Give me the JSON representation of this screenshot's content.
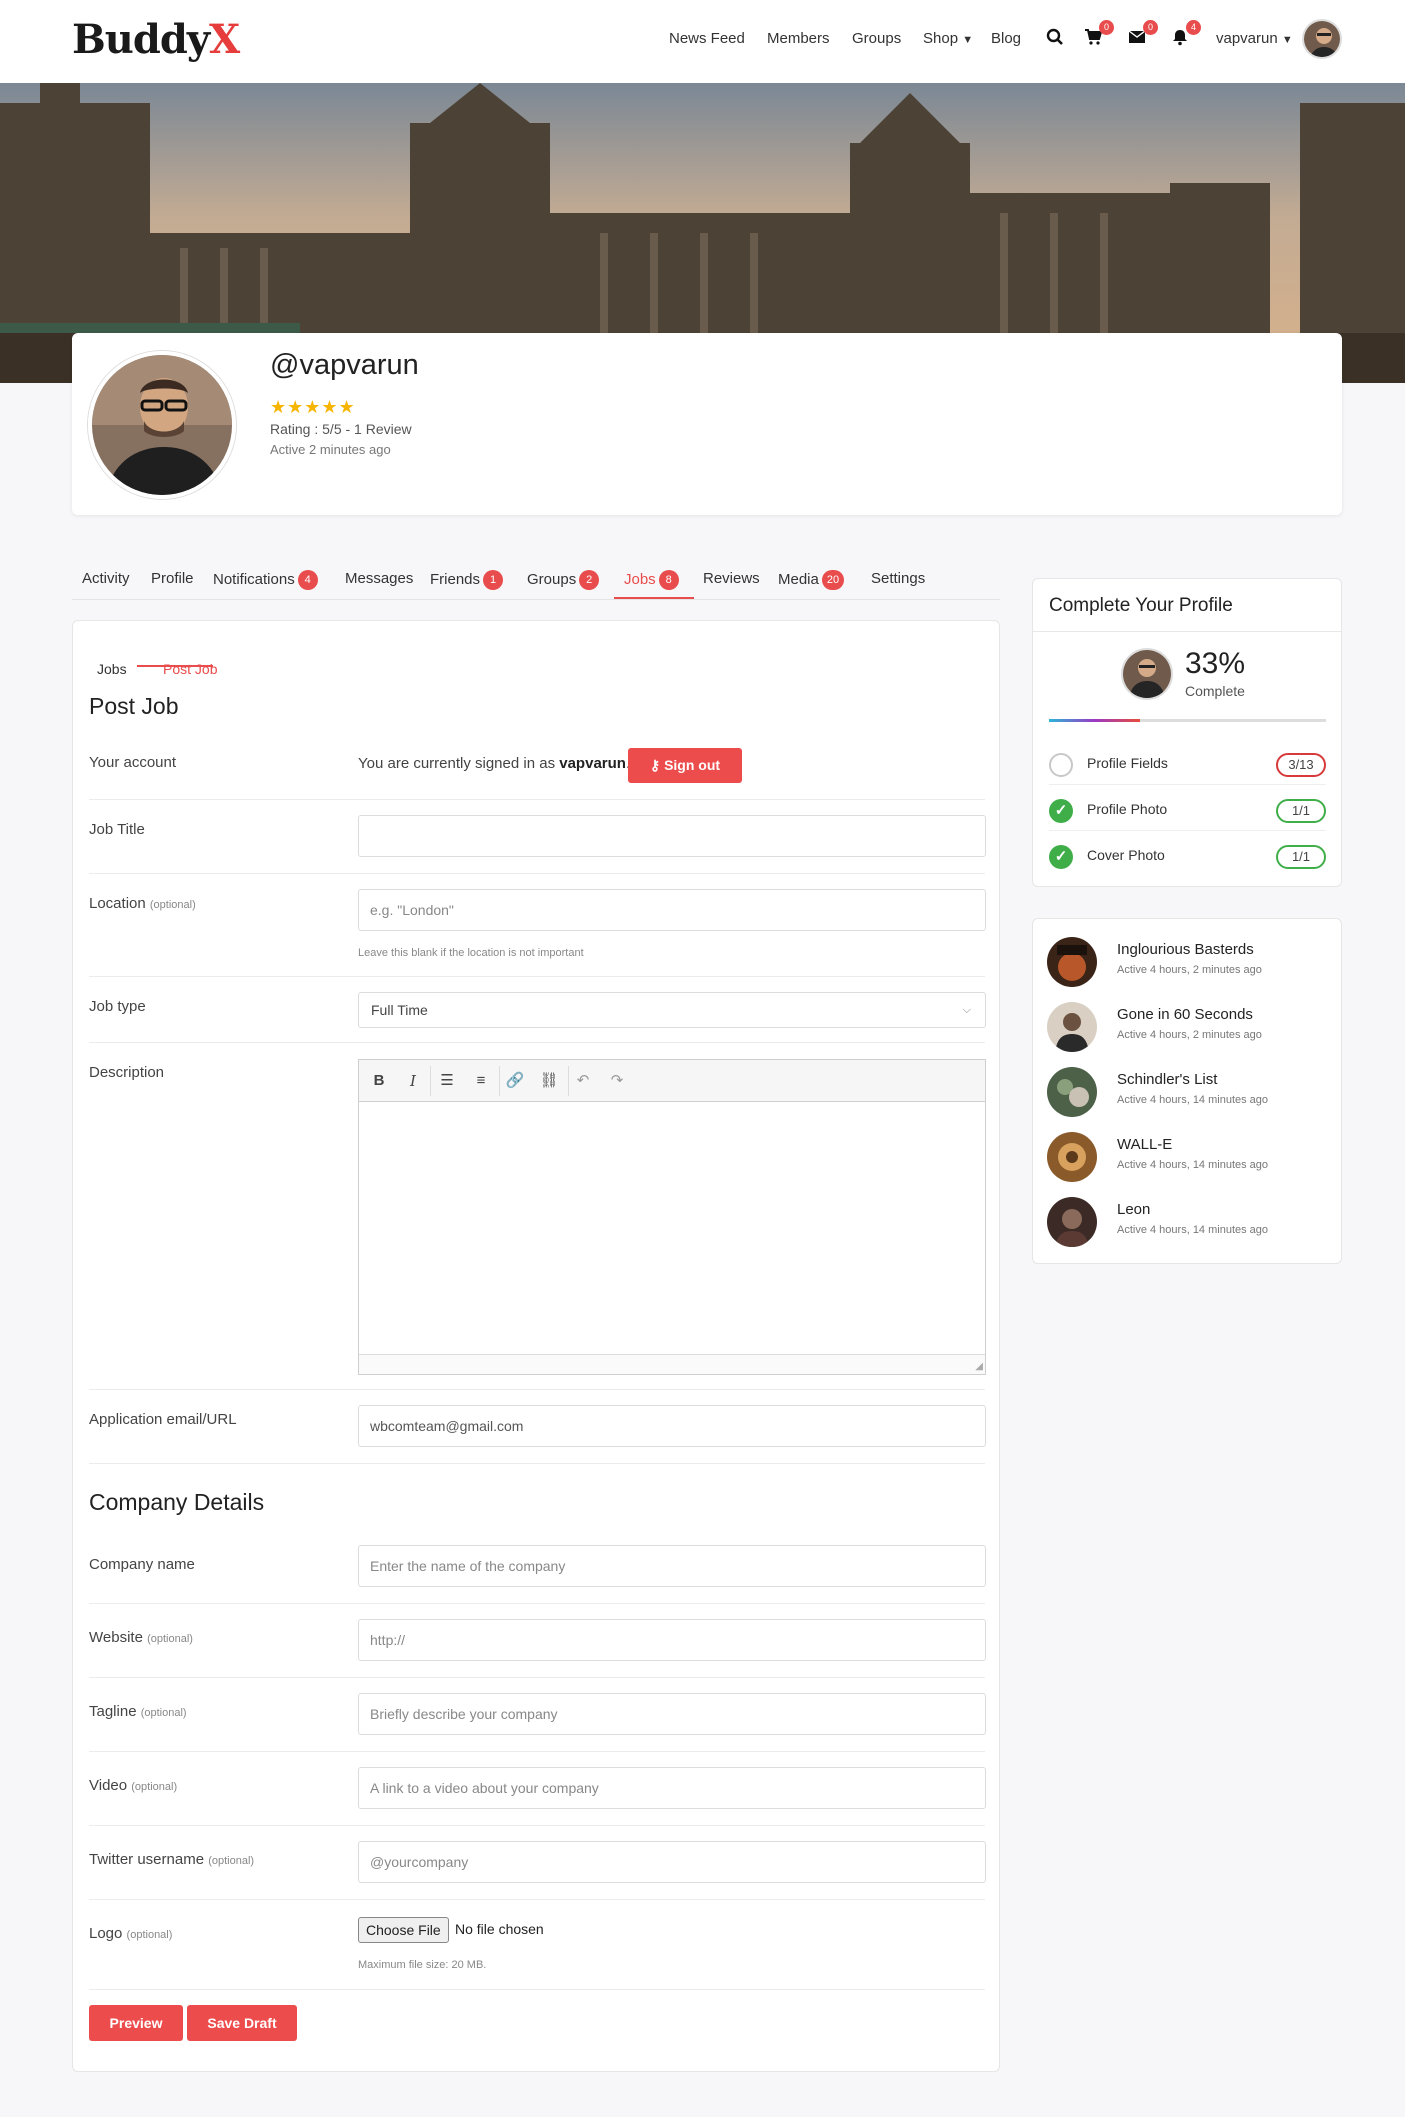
{
  "header": {
    "logo_main": "Buddy",
    "logo_accent": "X",
    "nav": [
      "News Feed",
      "Members",
      "Groups",
      "Shop",
      "Blog"
    ],
    "cart_count": "0",
    "messages_count": "0",
    "notifications_count": "4",
    "username": "vapvarun"
  },
  "profile": {
    "handle": "@vapvarun",
    "stars": "★★★★★",
    "rating": "Rating : 5/5 - 1 Review",
    "active": "Active 2 minutes ago"
  },
  "tabs": [
    {
      "label": "Activity"
    },
    {
      "label": "Profile"
    },
    {
      "label": "Notifications",
      "badge": "4"
    },
    {
      "label": "Messages"
    },
    {
      "label": "Friends",
      "badge": "1"
    },
    {
      "label": "Groups",
      "badge": "2"
    },
    {
      "label": "Jobs",
      "badge": "8"
    },
    {
      "label": "Reviews"
    },
    {
      "label": "Media",
      "badge": "20"
    },
    {
      "label": "Settings"
    }
  ],
  "subtabs": [
    "Jobs",
    "Post Job"
  ],
  "form": {
    "title": "Post Job",
    "account_label": "Your account",
    "signed_in_prefix": "You are currently signed in as",
    "signed_in_user": "vapvarun",
    "signout_label": "Sign out",
    "job_title_label": "Job Title",
    "job_title_value": "",
    "location_label": "Location",
    "optional": "(optional)",
    "location_placeholder": "e.g. \"London\"",
    "location_hint": "Leave this blank if the location is not important",
    "job_type_label": "Job type",
    "job_type_value": "Full Time",
    "description_label": "Description",
    "app_label": "Application email/URL",
    "app_value": "wbcomteam@gmail.com"
  },
  "company": {
    "title": "Company Details",
    "name_label": "Company name",
    "name_placeholder": "Enter the name of the company",
    "website_label": "Website",
    "website_placeholder": "http://",
    "tagline_label": "Tagline",
    "tagline_placeholder": "Briefly describe your company",
    "video_label": "Video",
    "video_placeholder": "A link to a video about your company",
    "twitter_label": "Twitter username",
    "twitter_placeholder": "@yourcompany",
    "logo_label": "Logo",
    "choose_file": "Choose File",
    "no_file": "No file chosen",
    "max_size": "Maximum file size: 20 MB."
  },
  "buttons": {
    "preview": "Preview",
    "save_draft": "Save Draft"
  },
  "complete_profile": {
    "title": "Complete Your Profile",
    "percent": "33%",
    "percent_value": 33,
    "complete_label": "Complete",
    "items": [
      {
        "label": "Profile Fields",
        "count": "3/13",
        "done": false
      },
      {
        "label": "Profile Photo",
        "count": "1/1",
        "done": true
      },
      {
        "label": "Cover Photo",
        "count": "1/1",
        "done": true
      }
    ]
  },
  "groups": [
    {
      "name": "Inglourious Basterds",
      "active": "Active 4 hours, 2 minutes ago"
    },
    {
      "name": "Gone in 60 Seconds",
      "active": "Active 4 hours, 2 minutes ago"
    },
    {
      "name": "Schindler's List",
      "active": "Active 4 hours, 14 minutes ago"
    },
    {
      "name": "WALL-E",
      "active": "Active 4 hours, 14 minutes ago"
    },
    {
      "name": "Leon",
      "active": "Active 4 hours, 14 minutes ago"
    }
  ]
}
